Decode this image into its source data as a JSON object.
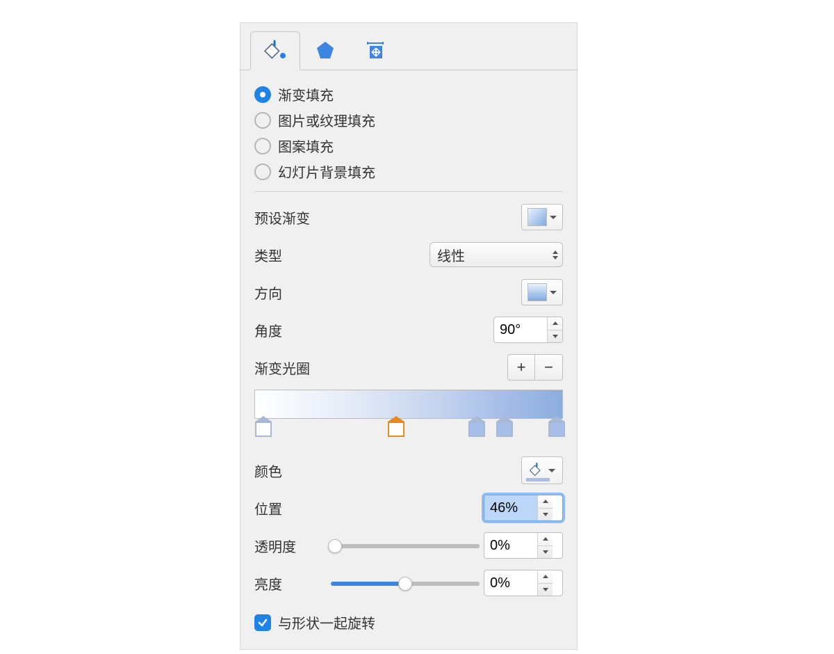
{
  "fillTypes": {
    "gradient": "渐变填充",
    "picture": "图片或纹理填充",
    "pattern": "图案填充",
    "slideBg": "幻灯片背景填充",
    "selected": "gradient"
  },
  "labels": {
    "preset": "预设渐变",
    "type": "类型",
    "direction": "方向",
    "angle": "角度",
    "stops": "渐变光圈",
    "color": "颜色",
    "position": "位置",
    "transparency": "透明度",
    "brightness": "亮度"
  },
  "values": {
    "type": "线性",
    "angle": "90°",
    "position": "46%",
    "transparency": "0%",
    "brightness": "0%",
    "transparencySlider": 0,
    "brightnessSlider": 50
  },
  "gradientStops": [
    0,
    46,
    72,
    81,
    98
  ],
  "activeStop": 1,
  "rotateWithShape": {
    "label": "与形状一起旋转",
    "checked": true
  },
  "colors": {
    "presetStart": "#eaf2fc",
    "presetEnd": "#7fa9e0",
    "currentStop": "#a6bee8"
  }
}
